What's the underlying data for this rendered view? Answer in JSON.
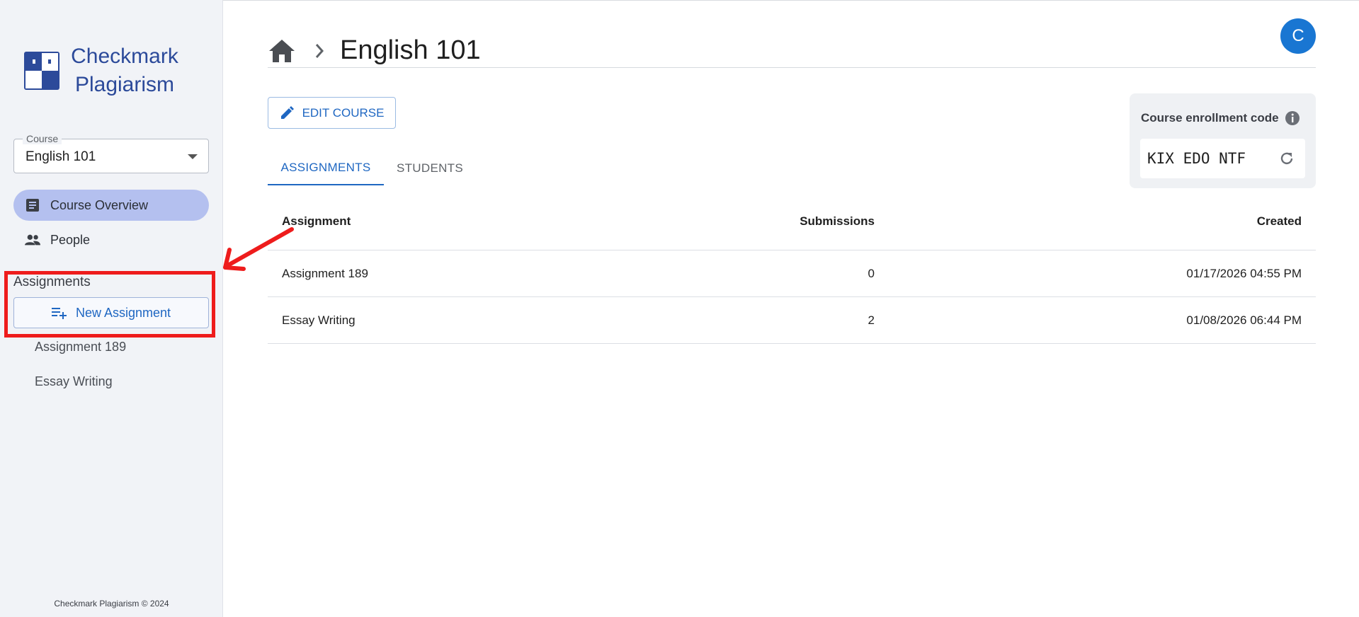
{
  "brand": {
    "line1": "Checkmark",
    "line2": "Plagiarism"
  },
  "sidebar": {
    "course_label": "Course",
    "course_value": "English 101",
    "nav": [
      {
        "label": "Course Overview",
        "icon": "article-icon",
        "active": true
      },
      {
        "label": "People",
        "icon": "people-icon",
        "active": false
      }
    ],
    "assignments_heading": "Assignments",
    "new_assignment_label": "New Assignment",
    "assignment_links": [
      "Assignment 189",
      "Essay Writing"
    ],
    "footer": "Checkmark Plagiarism © 2024"
  },
  "header": {
    "breadcrumb_title": "English 101",
    "avatar_initial": "C"
  },
  "actions": {
    "edit_course_label": "EDIT COURSE"
  },
  "tabs": [
    {
      "label": "ASSIGNMENTS",
      "active": true
    },
    {
      "label": "STUDENTS",
      "active": false
    }
  ],
  "enrollment": {
    "label": "Course enrollment code",
    "code": "KIX EDO NTF"
  },
  "table": {
    "columns": [
      "Assignment",
      "Submissions",
      "Created"
    ],
    "rows": [
      {
        "assignment": "Assignment 189",
        "submissions": "0",
        "created": "01/17/2026 04:55 PM"
      },
      {
        "assignment": "Essay Writing",
        "submissions": "2",
        "created": "01/08/2026 06:44 PM"
      }
    ]
  },
  "colors": {
    "accent": "#1f67c2",
    "brand": "#2c4a9a",
    "active_nav": "#b4c0ef",
    "avatar": "#1976d2",
    "highlight": "#ee1c1c"
  }
}
